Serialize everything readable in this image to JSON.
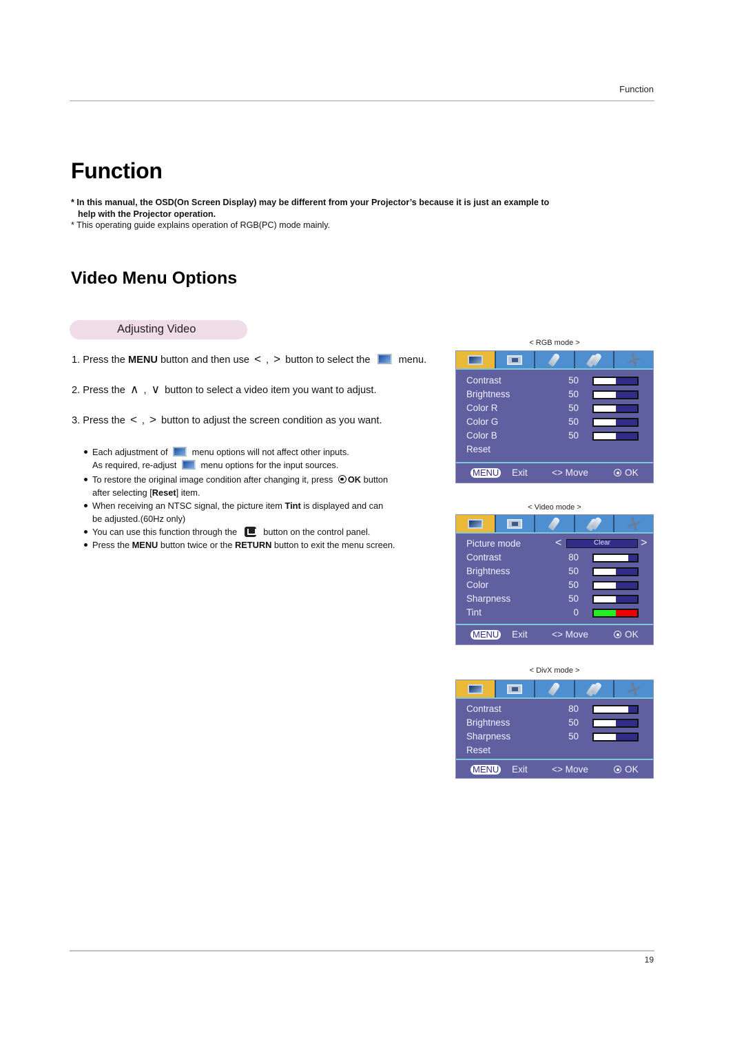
{
  "header": {
    "running_head": "Function",
    "page_number": "19"
  },
  "title": "Function",
  "notes": {
    "bold_line1": "* In this manual, the OSD(On Screen Display) may be different from your Projector’s because it is just an example to",
    "bold_line2": "help with the Projector operation.",
    "plain": "* This operating guide explains operation of RGB(PC) mode mainly."
  },
  "section_title": "Video Menu Options",
  "subsection_label": "Adjusting Video",
  "steps": {
    "s1": {
      "pre": "1. Press the ",
      "bold": "MENU",
      "mid": " button and then use ",
      "left": "<",
      "comma": " , ",
      "right": ">",
      "post": " button to select the ",
      "end": " menu."
    },
    "s2": {
      "pre": "2. Press the ",
      "up": "∧",
      "comma": " , ",
      "down": "∨",
      "post": " button to select a video item you want to adjust."
    },
    "s3": {
      "pre": "3. Press the ",
      "left": "<",
      "comma": " , ",
      "right": ">",
      "post": " button to adjust the screen condition as you want."
    }
  },
  "bullets": {
    "b1a_pre": "Each adjustment of ",
    "b1a_post": " menu options will not affect other inputs.",
    "b1b_pre": "As required, re-adjust ",
    "b1b_post": " menu options for the input sources.",
    "b2_pre": "To restore the original image condition after changing it, press ",
    "b2_ok": "OK",
    "b2_post": " button",
    "b2_line2_pre": "after selecting [",
    "b2_reset": "Reset",
    "b2_line2_post": "] item.",
    "b3_pre": "When receiving an NTSC signal, the picture item ",
    "b3_tint": "Tint",
    "b3_post": " is displayed and can",
    "b3_line2": "be adjusted.(60Hz only)",
    "b4_pre": "You can use this function through the ",
    "b4_post": " button on the control panel.",
    "b5_pre": "Press the ",
    "b5_menu": "MENU",
    "b5_mid": " button twice or the ",
    "b5_return": "RETURN",
    "b5_post": " button to exit the menu screen."
  },
  "osd_footer": {
    "menu": "MENU",
    "exit": "Exit",
    "move": "<> Move",
    "ok": "OK"
  },
  "osd_panels": {
    "rgb": {
      "caption": "< RGB mode >",
      "rows": [
        {
          "label": "Contrast",
          "value": "50",
          "level_percent": 50
        },
        {
          "label": "Brightness",
          "value": "50",
          "level_percent": 50
        },
        {
          "label": "Color  R",
          "value": "50",
          "level_percent": 50
        },
        {
          "label": "Color  G",
          "value": "50",
          "level_percent": 50
        },
        {
          "label": "Color  B",
          "value": "50",
          "level_percent": 50
        },
        {
          "label": "Reset"
        }
      ]
    },
    "video": {
      "caption": "< Video mode >",
      "picture_mode": {
        "label": "Picture mode",
        "value": "Clear",
        "prev": "<",
        "next": ">"
      },
      "rows": [
        {
          "label": "Contrast",
          "value": "80",
          "level_percent": 80
        },
        {
          "label": "Brightness",
          "value": "50",
          "level_percent": 50
        },
        {
          "label": "Color",
          "value": "50",
          "level_percent": 50
        },
        {
          "label": "Sharpness",
          "value": "50",
          "level_percent": 50
        },
        {
          "label": "Tint",
          "value": "0",
          "level_percent": 50
        }
      ]
    },
    "divx": {
      "caption": "< DivX mode >",
      "rows": [
        {
          "label": "Contrast",
          "value": "80",
          "level_percent": 80
        },
        {
          "label": "Brightness",
          "value": "50",
          "level_percent": 50
        },
        {
          "label": "Sharpness",
          "value": "50",
          "level_percent": 50
        },
        {
          "label": "Reset"
        }
      ]
    }
  },
  "osd_tabs": [
    "picture-tab",
    "screen-tab",
    "option-tab",
    "special-tab",
    "setup-tab"
  ]
}
